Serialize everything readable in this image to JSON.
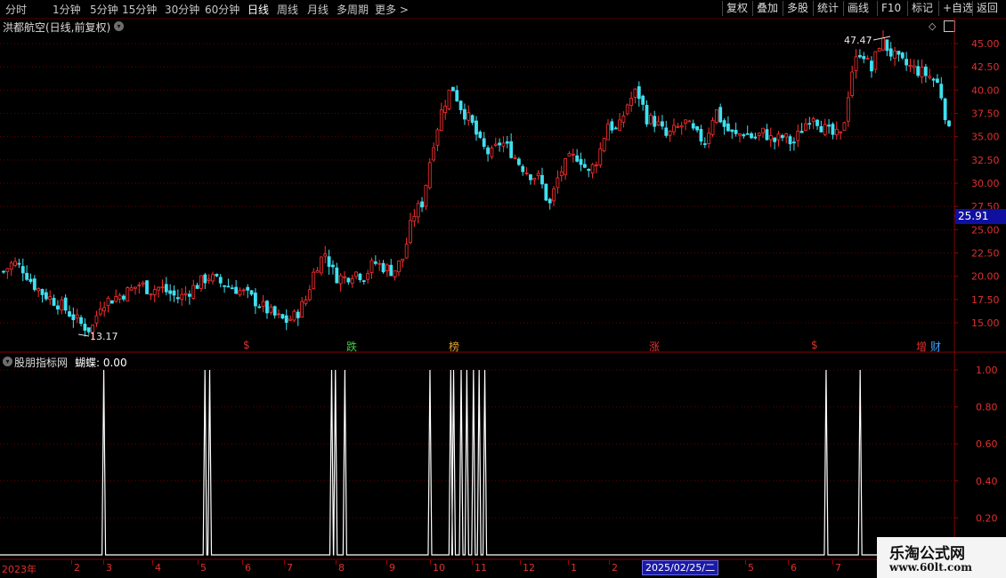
{
  "toolbar": {
    "periods": [
      "分时",
      "1分钟",
      "5分钟",
      "15分钟",
      "30分钟",
      "60分钟",
      "日线",
      "周线",
      "月线",
      "多周期",
      "更多 >"
    ],
    "active_period": "日线",
    "buttons": [
      "复权",
      "叠加",
      "多股",
      "统计",
      "画线",
      "F10",
      "标记",
      "+自选",
      "返回"
    ]
  },
  "main_pane": {
    "title": "洪都航空(日线,前复权)",
    "high_label": "47.47",
    "low_label": "13.17",
    "current_price": "25.91",
    "signals": [
      {
        "text": "$",
        "color": "#e03030"
      },
      {
        "text": "跌",
        "color": "#40d040"
      },
      {
        "text": "榜",
        "color": "#e0a030"
      },
      {
        "text": "涨",
        "color": "#e03030"
      },
      {
        "text": "$",
        "color": "#e03030"
      },
      {
        "text": "增",
        "color": "#e03030"
      },
      {
        "text": "财",
        "color": "#40a0ff"
      }
    ]
  },
  "indicator_pane": {
    "title": "股朋指标网",
    "value_label": "蝴蝶: 0.00"
  },
  "time_axis": {
    "labels": [
      "2023年",
      "2",
      "3",
      "4",
      "5",
      "6",
      "7",
      "8",
      "9",
      "10",
      "11",
      "12",
      "1",
      "2",
      "3",
      "4",
      "5",
      "6",
      "7"
    ],
    "cursor_date": "2025/02/25/二"
  },
  "watermark": {
    "line1": "乐淘公式网",
    "line2": "www.60lt.com"
  },
  "colors": {
    "up": "#ff3030",
    "down": "#40e0f0",
    "grid": "#6a0000",
    "axis_text": "#e03030"
  },
  "chart_data": [
    {
      "type": "candlestick",
      "title": "洪都航空(日线,前复权)",
      "y_ticks": [
        15.0,
        17.5,
        20.0,
        22.5,
        25.0,
        27.5,
        30.0,
        32.5,
        35.0,
        37.5,
        40.0,
        42.5,
        45.0
      ],
      "ylim": [
        12.5,
        47.5
      ],
      "annotations": [
        {
          "label": "47.47",
          "kind": "high"
        },
        {
          "label": "13.17",
          "kind": "low"
        }
      ],
      "close_path": [
        20.5,
        21.5,
        20.8,
        19.2,
        18.2,
        17.5,
        16.8,
        15.8,
        14.8,
        14.2,
        17.2,
        17.5,
        18.0,
        18.5,
        19.2,
        18.5,
        18.8,
        18.2,
        17.6,
        18.4,
        19.2,
        20.0,
        19.4,
        19.0,
        18.6,
        18.0,
        17.2,
        16.4,
        15.6,
        15.2,
        15.8,
        17.5,
        21.0,
        22.5,
        20.0,
        19.8,
        20.5,
        20.0,
        21.5,
        21.0,
        20.5,
        22.0,
        26.5,
        28.0,
        34.0,
        38.0,
        40.5,
        38.0,
        36.5,
        34.0,
        33.0,
        34.5,
        33.5,
        32.0,
        31.0,
        30.5,
        27.5,
        31.0,
        32.5,
        33.0,
        31.0,
        32.8,
        36.5,
        35.5,
        38.5,
        40.0,
        37.0,
        36.5,
        35.0,
        35.8,
        36.5,
        35.2,
        34.5,
        38.0,
        36.0,
        35.0,
        35.5,
        34.8,
        35.5,
        34.5,
        35.0,
        34.2,
        36.0,
        37.5,
        36.0,
        35.2,
        35.0,
        42.0,
        44.5,
        42.0,
        45.5,
        44.0,
        43.0,
        42.5,
        42.0,
        41.5,
        40.5,
        35.5
      ]
    },
    {
      "type": "line",
      "series_name": "蝴蝶",
      "ylim": [
        0,
        1.0
      ],
      "y_ticks": [
        0.2,
        0.4,
        0.6,
        0.8,
        1.0
      ],
      "current_value": 0.0,
      "pulse_positions_pct": [
        0.0,
        10.6,
        21.3,
        21.8,
        34.7,
        35.1,
        36.1,
        45.1,
        47.3,
        47.6,
        48.4,
        49.0,
        49.7,
        50.3,
        50.9,
        87.0,
        90.6
      ]
    }
  ]
}
